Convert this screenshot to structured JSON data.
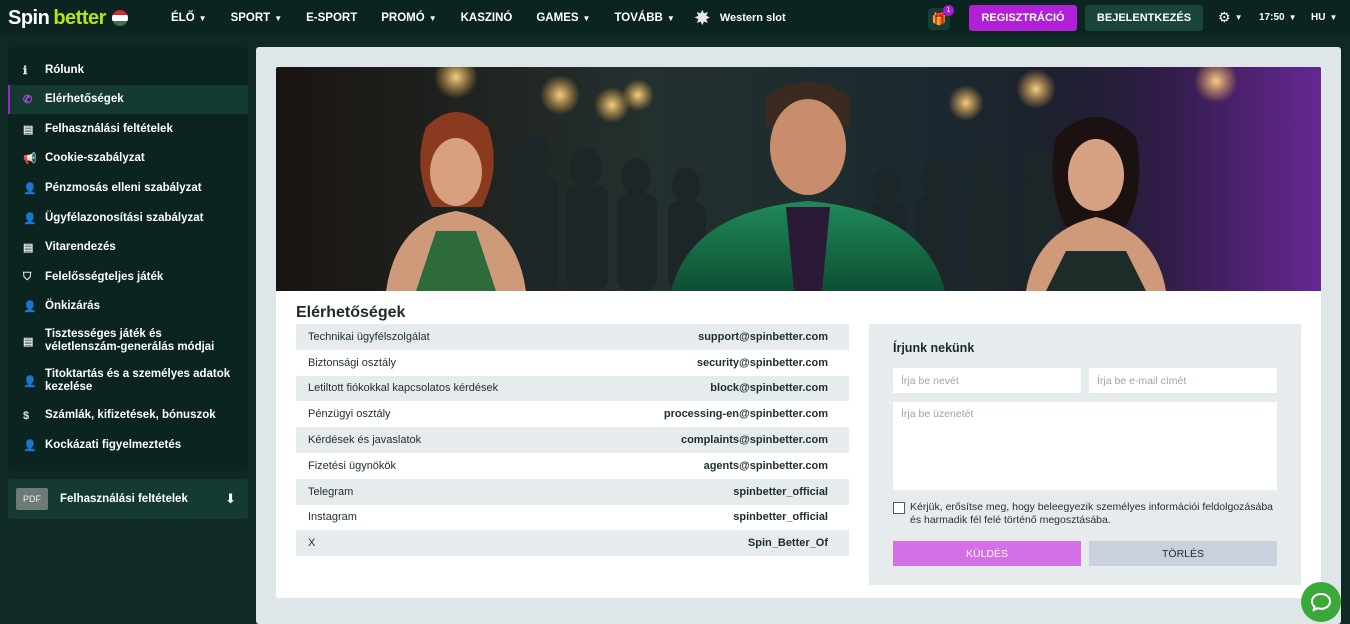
{
  "brand": {
    "part1": "Spin",
    "part2": "better"
  },
  "nav": {
    "items": [
      {
        "label": "ÉLŐ",
        "dropdown": true
      },
      {
        "label": "SPORT",
        "dropdown": true
      },
      {
        "label": "E-SPORT",
        "dropdown": false
      },
      {
        "label": "PROMÓ",
        "dropdown": true
      },
      {
        "label": "KASZINÓ",
        "dropdown": false
      },
      {
        "label": "GAMES",
        "dropdown": true
      },
      {
        "label": "TOVÁBB",
        "dropdown": true
      }
    ],
    "slot_label": "Western slot"
  },
  "header": {
    "gift_count": "1",
    "register_label": "REGISZTRÁCIÓ",
    "login_label": "BEJELENTKEZÉS",
    "time": "17:50",
    "language": "HU"
  },
  "sidebar": {
    "items": [
      {
        "label": "Rólunk",
        "icon": "info-icon",
        "glyph": "ℹ",
        "active": false
      },
      {
        "label": "Elérhetőségek",
        "icon": "phone-icon",
        "glyph": "✆",
        "active": true
      },
      {
        "label": "Felhasználási feltételek",
        "icon": "document-icon",
        "glyph": "▤",
        "active": false
      },
      {
        "label": "Cookie-szabályzat",
        "icon": "megaphone-icon",
        "glyph": "📢",
        "active": false
      },
      {
        "label": "Pénzmosás elleni szabályzat",
        "icon": "user-icon",
        "glyph": "👤",
        "active": false
      },
      {
        "label": "Ügyfélazonosítási szabályzat",
        "icon": "user-icon",
        "glyph": "👤",
        "active": false
      },
      {
        "label": "Vitarendezés",
        "icon": "document-icon",
        "glyph": "▤",
        "active": false
      },
      {
        "label": "Felelősségteljes játék",
        "icon": "shield-icon",
        "glyph": "⛉",
        "active": false
      },
      {
        "label": "Önkizárás",
        "icon": "user-icon",
        "glyph": "👤",
        "active": false
      },
      {
        "label": "Tisztességes játék és véletlenszám-generálás módjai",
        "icon": "document-icon",
        "glyph": "▤",
        "active": false
      },
      {
        "label": "Titoktartás és a személyes adatok kezelése",
        "icon": "user-icon",
        "glyph": "👤",
        "active": false
      },
      {
        "label": "Számlák, kifizetések, bónuszok",
        "icon": "dollar-icon",
        "glyph": "$",
        "active": false
      },
      {
        "label": "Kockázati figyelmeztetés",
        "icon": "user-icon",
        "glyph": "👤",
        "active": false
      }
    ],
    "pdf": {
      "badge": "PDF",
      "label": "Felhasználási feltételek"
    }
  },
  "main": {
    "title": "Elérhetőségek",
    "contacts": [
      {
        "label": "Technikai ügyfélszolgálat",
        "value": "support@spinbetter.com"
      },
      {
        "label": "Biztonsági osztály",
        "value": "security@spinbetter.com"
      },
      {
        "label": "Letiltott fiókokkal kapcsolatos kérdések",
        "value": "block@spinbetter.com"
      },
      {
        "label": "Pénzügyi osztály",
        "value": "processing-en@spinbetter.com"
      },
      {
        "label": "Kérdések és javaslatok",
        "value": "complaints@spinbetter.com"
      },
      {
        "label": "Fizetési ügynökök",
        "value": "agents@spinbetter.com"
      },
      {
        "label": "Telegram",
        "value": "spinbetter_official"
      },
      {
        "label": "Instagram",
        "value": "spinbetter_official"
      },
      {
        "label": "X",
        "value": "Spin_Better_Of"
      }
    ]
  },
  "form": {
    "title": "Írjunk nekünk",
    "name_placeholder": "Írja be nevét",
    "email_placeholder": "Írja be e-mail címét",
    "message_placeholder": "Írja be üzenetét",
    "consent": "Kérjük, erősítse meg, hogy beleegyezik személyes információi feldolgozásába és harmadik fél felé történő megosztásába.",
    "send_label": "KÜLDÉS",
    "clear_label": "TÖRLÉS"
  },
  "colors": {
    "accent": "#b21fd9",
    "brand_green": "#b6e31a",
    "page_bg": "#0f2a24",
    "chat": "#3ba83a"
  }
}
